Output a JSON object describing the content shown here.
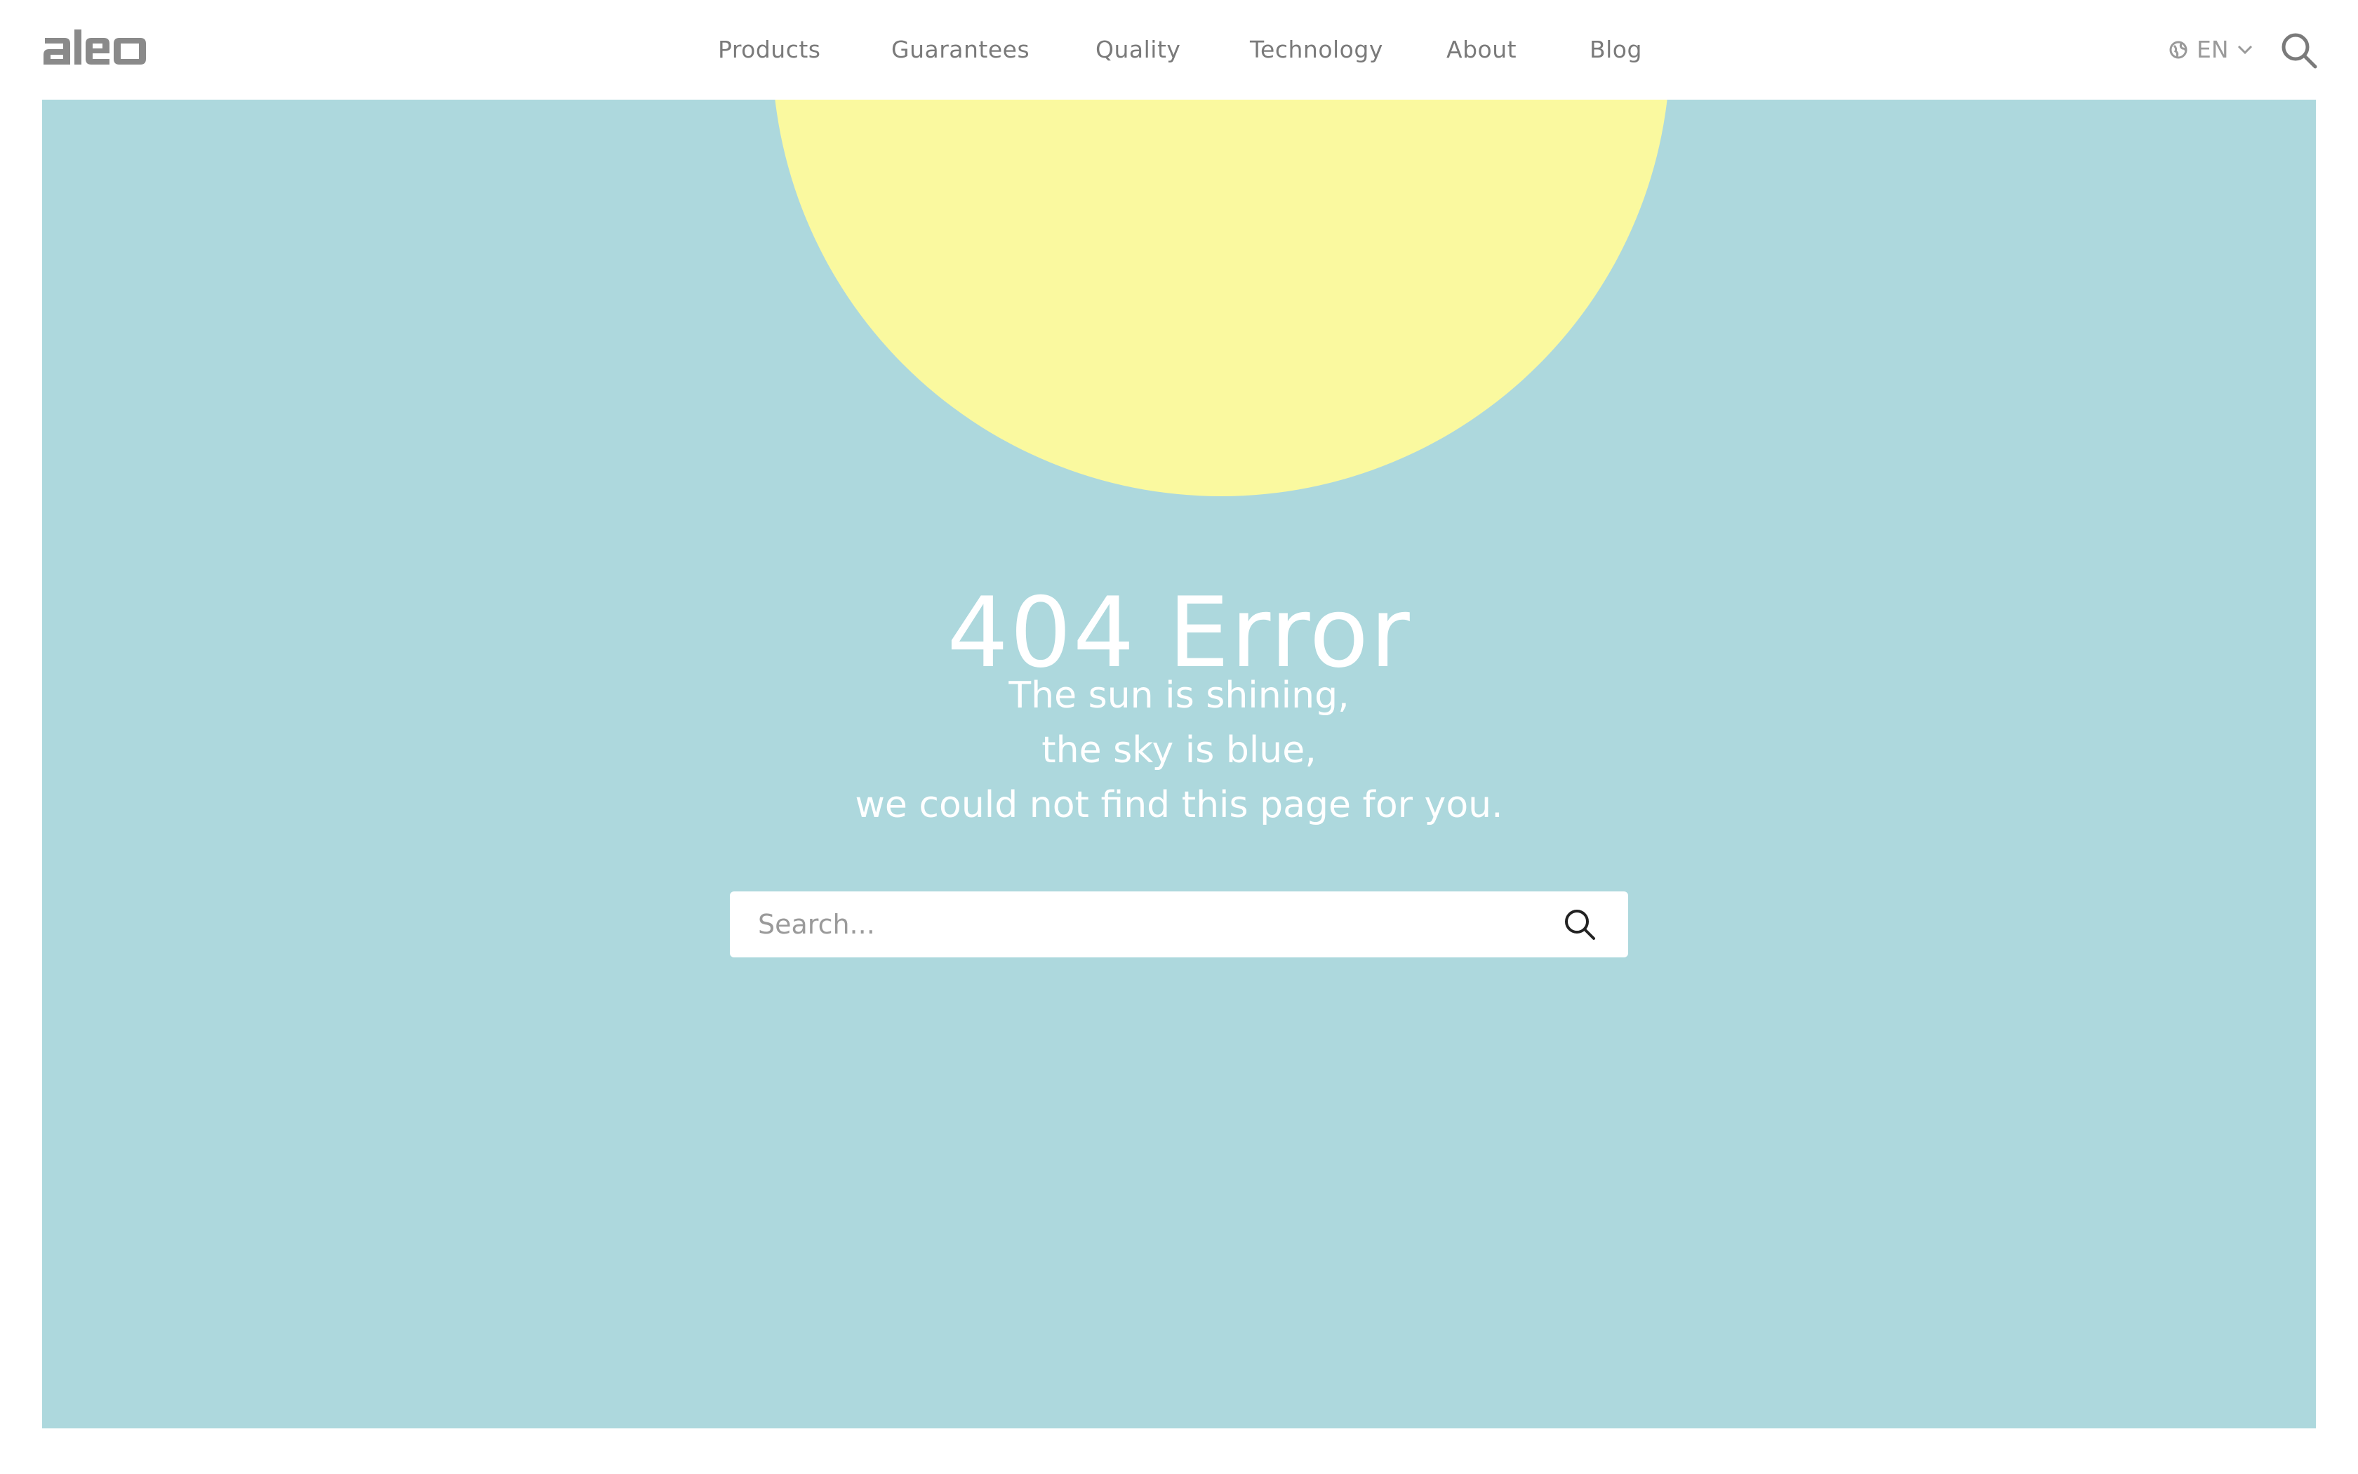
{
  "header": {
    "logo_text": "aleo",
    "nav": [
      {
        "label": "Products"
      },
      {
        "label": "Guarantees"
      },
      {
        "label": "Quality"
      },
      {
        "label": "Technology"
      },
      {
        "label": "About"
      },
      {
        "label": "Blog"
      }
    ],
    "language": "EN",
    "icons": {
      "globe": "globe-icon",
      "chevron": "chevron-down-icon",
      "search": "search-icon"
    }
  },
  "main": {
    "title": "404 Error",
    "message_lines": [
      "The sun is shining,",
      "the sky is blue,",
      "we could not find this page for you."
    ],
    "search": {
      "placeholder": "Search...",
      "value": ""
    }
  },
  "colors": {
    "sky": "#add8dd",
    "sun": "#faf99f",
    "nav_text": "#7a7a7a",
    "logo": "#8a8a8a",
    "text_light": "#ffffff"
  }
}
